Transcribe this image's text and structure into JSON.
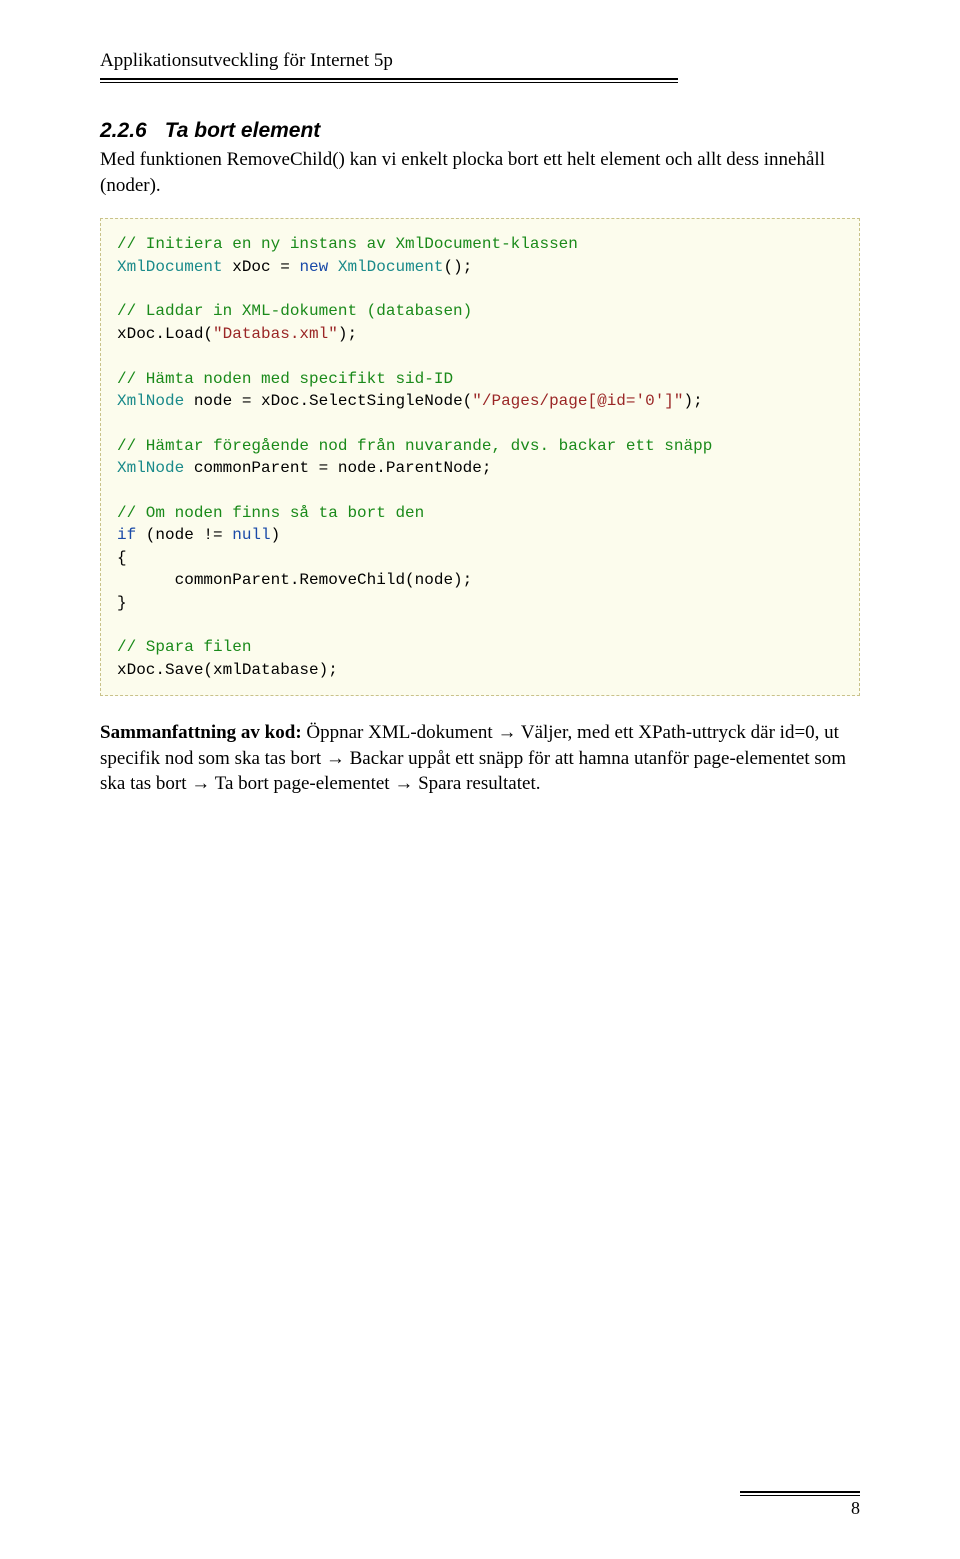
{
  "header": {
    "title": "Applikationsutveckling för Internet 5p"
  },
  "section": {
    "number": "2.2.6",
    "title": "Ta bort element",
    "intro": "Med funktionen RemoveChild() kan vi enkelt plocka bort ett helt element och allt dess innehåll (noder)."
  },
  "code": {
    "c1": "// Initiera en ny instans av XmlDocument-klassen",
    "c2a": "XmlDocument",
    "c2b": " xDoc = ",
    "c2c": "new",
    "c2d": "XmlDocument",
    "c2e": "();",
    "c3": "// Laddar in XML-dokument (databasen)",
    "c4a": "xDoc.Load(",
    "c4b": "\"Databas.xml\"",
    "c4c": ");",
    "c5": "// Hämta noden med specifikt sid-ID",
    "c6a": "XmlNode",
    "c6b": " node = xDoc.SelectSingleNode(",
    "c6c": "\"/Pages/page[@id='0']\"",
    "c6d": ");",
    "c7": "// Hämtar föregående nod från nuvarande, dvs. backar ett snäpp",
    "c8a": "XmlNode",
    "c8b": " commonParent = node.ParentNode;",
    "c9": "// Om noden finns så ta bort den",
    "c10a": "if",
    "c10b": " (node != ",
    "c10c": "null",
    "c10d": ")",
    "c11": "{",
    "c12": "      commonParent.RemoveChild(node);",
    "c13": "}",
    "c14": "// Spara filen",
    "c15": "xDoc.Save(xmlDatabase);"
  },
  "summary": {
    "label": "Sammanfattning av kod:",
    "s1": " Öppnar XML-dokument ",
    "s2": " Väljer, med ett XPath-uttryck där id=0, ut specifik nod som ska tas bort ",
    "s3": " Backar uppåt ett snäpp för att hamna utanför page-elementet som ska tas bort ",
    "s4": " Ta bort page-elementet ",
    "s5": " Spara resultatet.",
    "arrow": "→"
  },
  "footer": {
    "page": "8"
  }
}
